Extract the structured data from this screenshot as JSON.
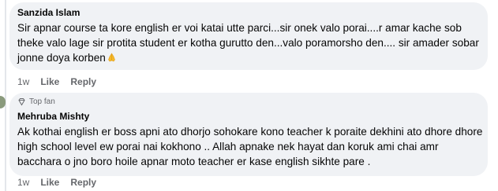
{
  "comments": [
    {
      "author": "Sanzida Islam",
      "badge": "",
      "text": "Sir apnar course ta kore english er voi katai utte parci...sir onek valo porai....r amar kache sob theke valo lage sir protita student er kotha gurutto den...valo poramorsho den.... sir amader sobar jonne doya korben",
      "emoji": "folded-hands-emoji",
      "time": "1w",
      "like_label": "Like",
      "reply_label": "Reply"
    },
    {
      "author": "Mehruba Mishty",
      "badge": "Top fan",
      "badge_icon": "diamond-badge-icon",
      "text": "Ak kothai english er boss apni ato dhorjo sohokare kono teacher k poraite dekhini ato dhore dhore high school level ew porai nai kokhono .. Allah apnake nek hayat dan koruk ami chai amr bacchara o jno boro hoile apnar moto teacher er kase english sikhte pare .",
      "time": "1w",
      "like_label": "Like",
      "reply_label": "Reply"
    }
  ],
  "colors": {
    "bubble": "#f0f2f5",
    "text": "#050505",
    "meta": "#65676b"
  }
}
